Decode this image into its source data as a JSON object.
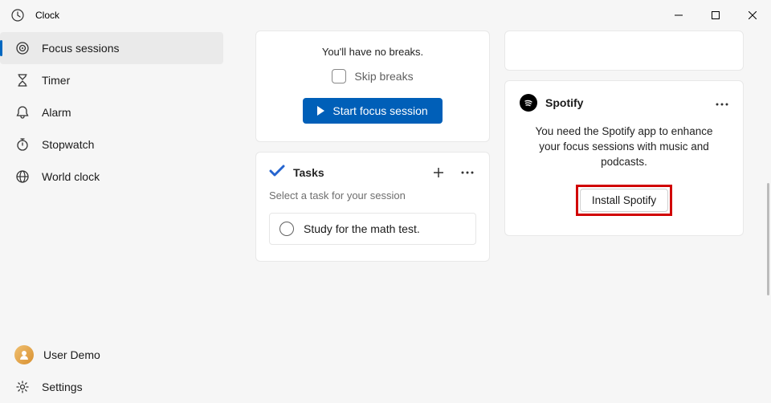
{
  "titlebar": {
    "app_name": "Clock"
  },
  "sidebar": {
    "items": [
      {
        "label": "Focus sessions"
      },
      {
        "label": "Timer"
      },
      {
        "label": "Alarm"
      },
      {
        "label": "Stopwatch"
      },
      {
        "label": "World clock"
      }
    ],
    "user_label": "User Demo",
    "settings_label": "Settings"
  },
  "focus": {
    "breaks_text": "You'll have no breaks.",
    "skip_label": "Skip breaks",
    "start_label": "Start focus session"
  },
  "tasks": {
    "title": "Tasks",
    "hint": "Select a task for your session",
    "items": [
      {
        "text": "Study for the math test."
      }
    ]
  },
  "spotify": {
    "title": "Spotify",
    "message": "You need the Spotify app to enhance your focus sessions with music and podcasts.",
    "install_label": "Install Spotify"
  }
}
